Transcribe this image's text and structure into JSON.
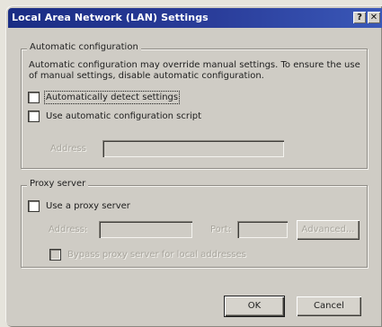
{
  "window": {
    "title": "Local Area Network (LAN) Settings",
    "help_button": "?",
    "close_button": "✕"
  },
  "auto_config": {
    "group_label": "Automatic configuration",
    "description": "Automatic configuration may override manual settings.  To ensure the use of manual settings, disable automatic configuration.",
    "detect_label": "Automatically detect settings",
    "detect_checked": false,
    "script_label": "Use automatic configuration script",
    "script_checked": false,
    "address_label": "Address",
    "address_value": ""
  },
  "proxy": {
    "group_label": "Proxy server",
    "use_proxy_label": "Use a proxy server",
    "use_proxy_checked": false,
    "address_label": "Address:",
    "address_value": "",
    "port_label": "Port:",
    "port_value": "",
    "advanced_label": "Advanced...",
    "bypass_label": "Bypass proxy server for local addresses",
    "bypass_checked": false
  },
  "footer": {
    "ok_label": "OK",
    "cancel_label": "Cancel"
  },
  "colors": {
    "titlebar_start": "#1a2d84",
    "titlebar_end": "#3a58b8",
    "dialog_face": "#cfccc5",
    "disabled_text": "#a8a59d"
  }
}
